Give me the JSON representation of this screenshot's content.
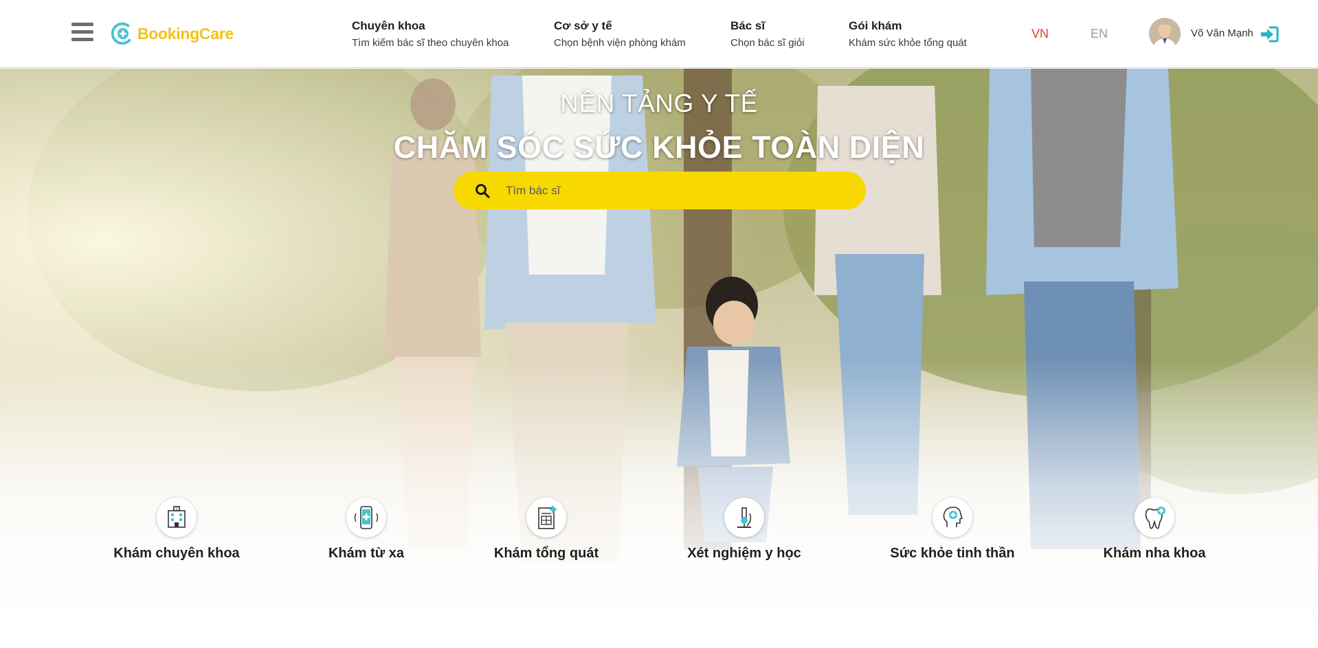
{
  "app": {
    "logo_text": "BookingCare"
  },
  "nav": {
    "items": [
      {
        "title": "Chuyên khoa",
        "subtitle": "Tìm kiếm bác sĩ theo chuyên khoa"
      },
      {
        "title": "Cơ sở y tế",
        "subtitle": "Chọn bệnh viện phòng khám"
      },
      {
        "title": "Bác sĩ",
        "subtitle": "Chọn bác sĩ giỏi"
      },
      {
        "title": "Gói khám",
        "subtitle": "Khám sức khỏe tổng quát"
      }
    ]
  },
  "language": {
    "vn": "VN",
    "en": "EN",
    "active": "VN",
    "active_color": "#e53935"
  },
  "user": {
    "name": "Võ Văn Mạnh"
  },
  "hero": {
    "title_line1": "NỀN TẢNG Y TẾ",
    "title_line2": "CHĂM SÓC SỨC KHỎE TOÀN DIỆN",
    "search_placeholder": "Tìm bác sĩ"
  },
  "options": [
    {
      "label": "Khám chuyên khoa",
      "icon": "hospital-icon"
    },
    {
      "label": "Khám từ xa",
      "icon": "phone-telemedicine-icon"
    },
    {
      "label": "Khám tổng quát",
      "icon": "clipboard-checkup-icon"
    },
    {
      "label": "Xét nghiệm y học",
      "icon": "microscope-icon"
    },
    {
      "label": "Sức khỏe tinh thần",
      "icon": "mental-health-icon"
    },
    {
      "label": "Khám nha khoa",
      "icon": "tooth-icon"
    }
  ],
  "colors": {
    "brand_yellow": "#f2c21b",
    "brand_cyan": "#45c3d2",
    "search_yellow": "#f7d800"
  }
}
